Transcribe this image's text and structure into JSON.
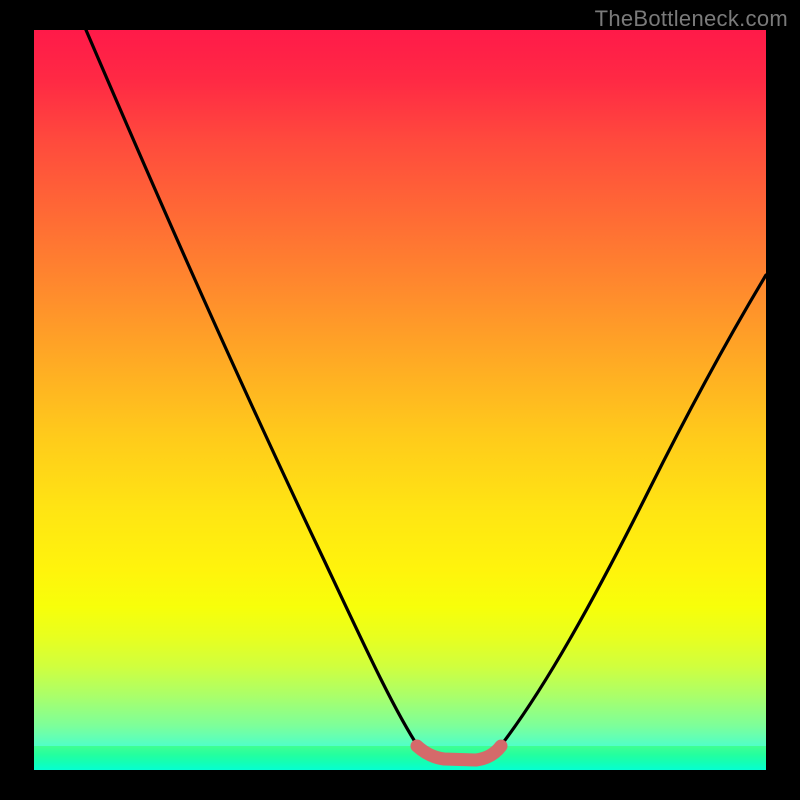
{
  "watermark": "TheBottleneck.com",
  "colors": {
    "frame": "#000000",
    "gradient_top": "#ff1a49",
    "gradient_bottom": "#00fff7",
    "curve_stroke": "#000000",
    "optimal_stroke": "#d56a6a"
  },
  "chart_data": {
    "type": "line",
    "title": "",
    "xlabel": "",
    "ylabel": "",
    "xlim": [
      0,
      100
    ],
    "ylim": [
      0,
      100
    ],
    "grid": false,
    "legend": false,
    "series": [
      {
        "name": "left-branch",
        "x": [
          8,
          15,
          22,
          30,
          38,
          45,
          50,
          53
        ],
        "y": [
          100,
          85,
          70,
          54,
          37,
          20,
          6,
          2
        ]
      },
      {
        "name": "optimal-zone",
        "x": [
          53,
          55,
          57,
          59,
          61,
          63
        ],
        "y": [
          2,
          1,
          0.8,
          0.8,
          1,
          2
        ]
      },
      {
        "name": "right-branch",
        "x": [
          63,
          68,
          74,
          82,
          90,
          100
        ],
        "y": [
          2,
          9,
          20,
          35,
          50,
          67
        ]
      }
    ],
    "annotations": [
      {
        "text": "TheBottleneck.com",
        "position": "top-right"
      }
    ]
  }
}
